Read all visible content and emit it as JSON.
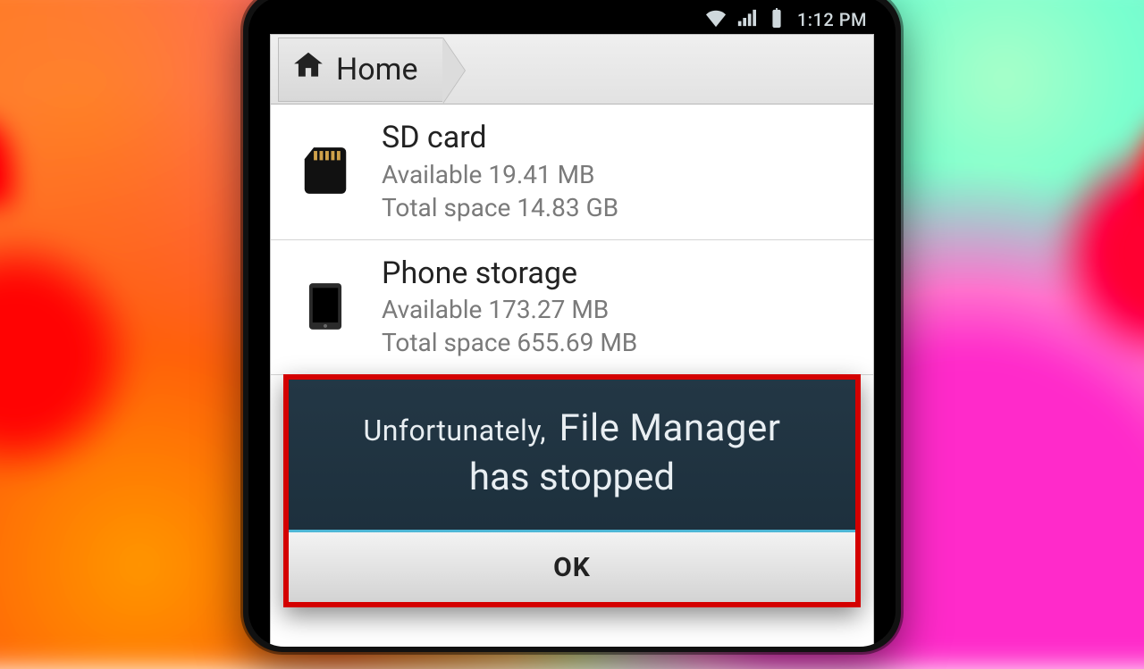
{
  "statusbar": {
    "time": "1:12 PM"
  },
  "breadcrumb": {
    "home": "Home"
  },
  "storage": [
    {
      "title": "SD card",
      "available": "Available 19.41 MB",
      "total": "Total space 14.83 GB"
    },
    {
      "title": "Phone storage",
      "available": "Available 173.27 MB",
      "total": "Total space 655.69 MB"
    }
  ],
  "dialog": {
    "prefix": "Unfortunately,",
    "app": "File Manager",
    "line2": "has stopped",
    "ok": "OK"
  }
}
